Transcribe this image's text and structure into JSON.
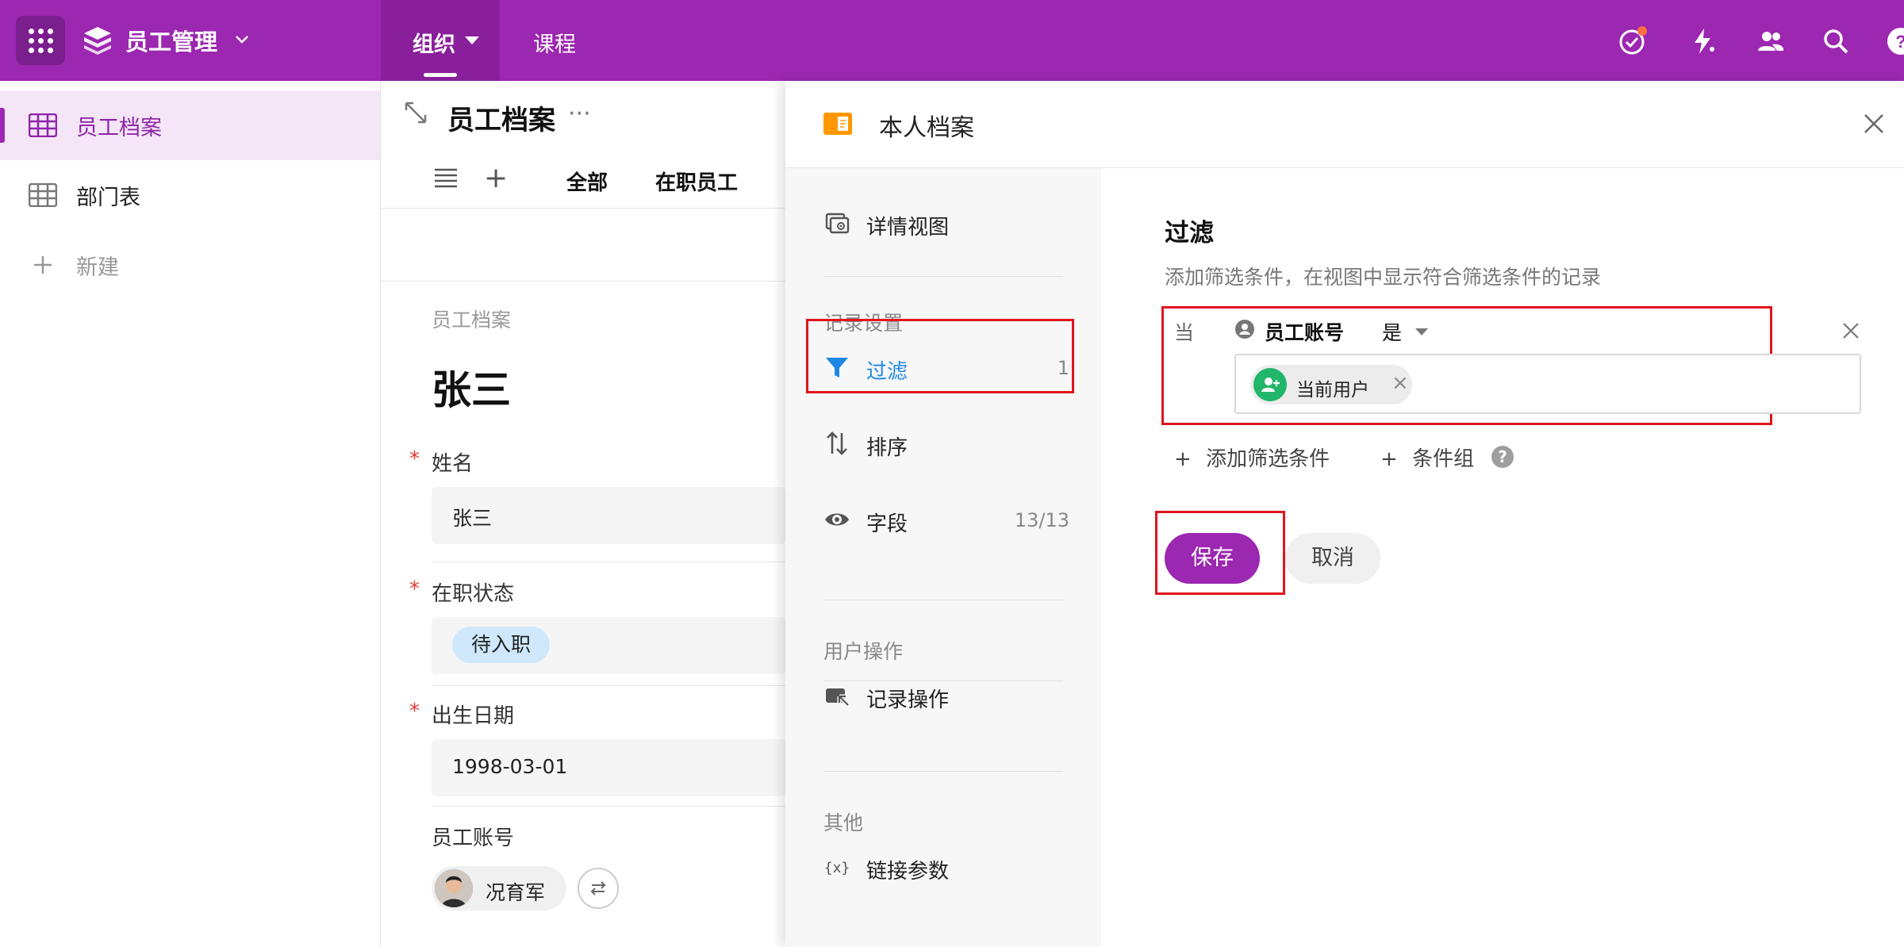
{
  "topbar": {
    "app_title": "员工管理",
    "tabs": [
      {
        "label": "组织",
        "active": true
      },
      {
        "label": "课程",
        "active": false
      }
    ],
    "brand_color": "#9c27b0",
    "icons": [
      "todo-check-icon",
      "automation-bolt-icon",
      "members-icon",
      "search-icon",
      "help-icon"
    ]
  },
  "sidebar": {
    "items": [
      {
        "label": "员工档案",
        "icon": "table-icon",
        "active": true
      },
      {
        "label": "部门表",
        "icon": "table-icon",
        "active": false
      },
      {
        "label": "新建",
        "icon": "plus-icon",
        "active": false
      }
    ]
  },
  "record": {
    "view_title": "员工档案",
    "tabs": [
      "全部",
      "在职员工"
    ],
    "crumb": "员工档案",
    "title": "张三",
    "fields": {
      "name": {
        "label": "姓名",
        "value": "张三",
        "required": "*"
      },
      "status": {
        "label": "在职状态",
        "value": "待入职",
        "required": "*"
      },
      "birth": {
        "label": "出生日期",
        "value": "1998-03-01",
        "required": "*"
      },
      "account": {
        "label": "员工账号",
        "value": "况育军"
      }
    }
  },
  "panel": {
    "title": "本人档案",
    "nav": {
      "detail_view": "详情视图",
      "section_record": "记录设置",
      "filter": {
        "label": "过滤",
        "count": "1"
      },
      "sort": "排序",
      "fields": {
        "label": "字段",
        "count": "13/13"
      },
      "section_user": "用户操作",
      "record_actions": "记录操作",
      "section_other": "其他",
      "link_params": "链接参数"
    },
    "filter": {
      "title": "过滤",
      "description": "添加筛选条件，在视图中显示符合筛选条件的记录",
      "when": "当",
      "field": "员工账号",
      "operator": "是",
      "value_chip": "当前用户",
      "add_condition": "添加筛选条件",
      "add_group": "条件组",
      "help": "?"
    },
    "buttons": {
      "save": "保存",
      "cancel": "取消"
    }
  }
}
